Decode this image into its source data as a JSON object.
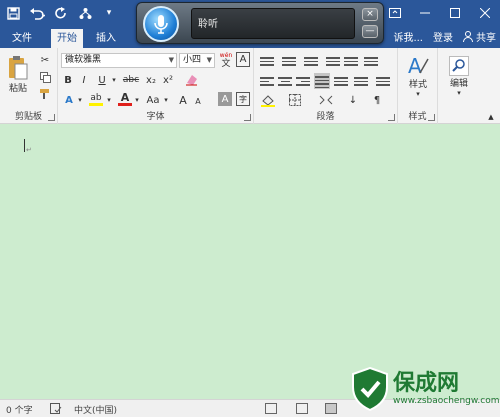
{
  "title_bar": {
    "qat": [
      "save-icon",
      "undo-icon",
      "redo-icon",
      "customize-icon"
    ],
    "window_buttons": [
      "minimize-icon",
      "restore-icon",
      "close-icon"
    ]
  },
  "voice": {
    "text": "聆听",
    "close_label": "×",
    "min_label": "—"
  },
  "tabs": [
    "文件",
    "开始",
    "插入"
  ],
  "tab_right": {
    "tell": "诉我...",
    "login": "登录",
    "share": "共享"
  },
  "ribbon": {
    "clipboard": {
      "paste": "粘贴",
      "label": "剪贴板"
    },
    "font": {
      "name": "微软雅黑",
      "size": "小四",
      "wen": "wén",
      "wen_char": "文",
      "label": "字体",
      "bold": "B",
      "italic": "I",
      "underline": "U",
      "strike": "abc",
      "sub": "x₂",
      "sup": "x²",
      "case": "Aa",
      "grow": "A",
      "shrink": "A"
    },
    "paragraph": {
      "label": "段落"
    },
    "styles": {
      "btn": "样式",
      "label": "样式"
    },
    "editing": {
      "btn": "编辑"
    }
  },
  "status": {
    "words": "0 个字",
    "lang": "中文(中国)"
  },
  "watermark": {
    "name": "保成网",
    "url": "www.zsbaochengw.com"
  },
  "colors": {
    "accent": "#2b579a",
    "doc_bg": "#cdeccf",
    "font_red": "#e0201b",
    "highlight": "#fff200"
  }
}
